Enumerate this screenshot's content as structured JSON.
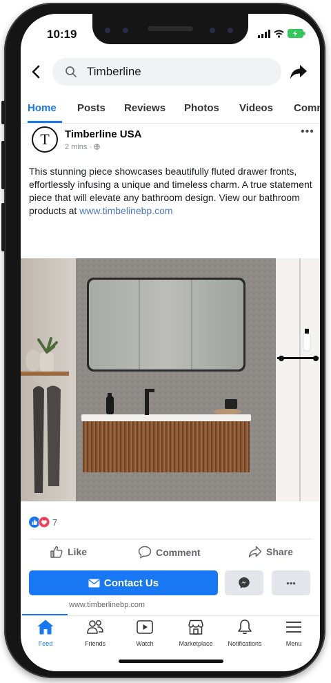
{
  "status_bar": {
    "time": "10:19"
  },
  "search": {
    "query": "Timberline"
  },
  "tabs": [
    {
      "label": "Home"
    },
    {
      "label": "Posts"
    },
    {
      "label": "Reviews"
    },
    {
      "label": "Photos"
    },
    {
      "label": "Videos"
    },
    {
      "label": "Comm"
    }
  ],
  "post": {
    "avatar_letter": "T",
    "page_name": "Timberline USA",
    "meta": "2 mins · ",
    "text": "This stunning piece showcases beautifully fluted drawer fronts, effortlessly infusing a unique and timeless charm. A true statement piece that will elevate any bathroom design. View our bathroom products at ",
    "link": "www.timbelinebp.com",
    "reaction_count": "7",
    "actions": {
      "like": "Like",
      "comment": "Comment",
      "share": "Share"
    },
    "contact_button": "Contact Us",
    "footer_url": "www.timberlinebp.com"
  },
  "nav": [
    {
      "label": "Feed"
    },
    {
      "label": "Friends"
    },
    {
      "label": "Watch"
    },
    {
      "label": "Marketplace"
    },
    {
      "label": "Notifications"
    },
    {
      "label": "Menu"
    }
  ],
  "colors": {
    "accent": "#1877f2",
    "link": "#4a78c2",
    "reaction_heart": "#f33e58"
  }
}
